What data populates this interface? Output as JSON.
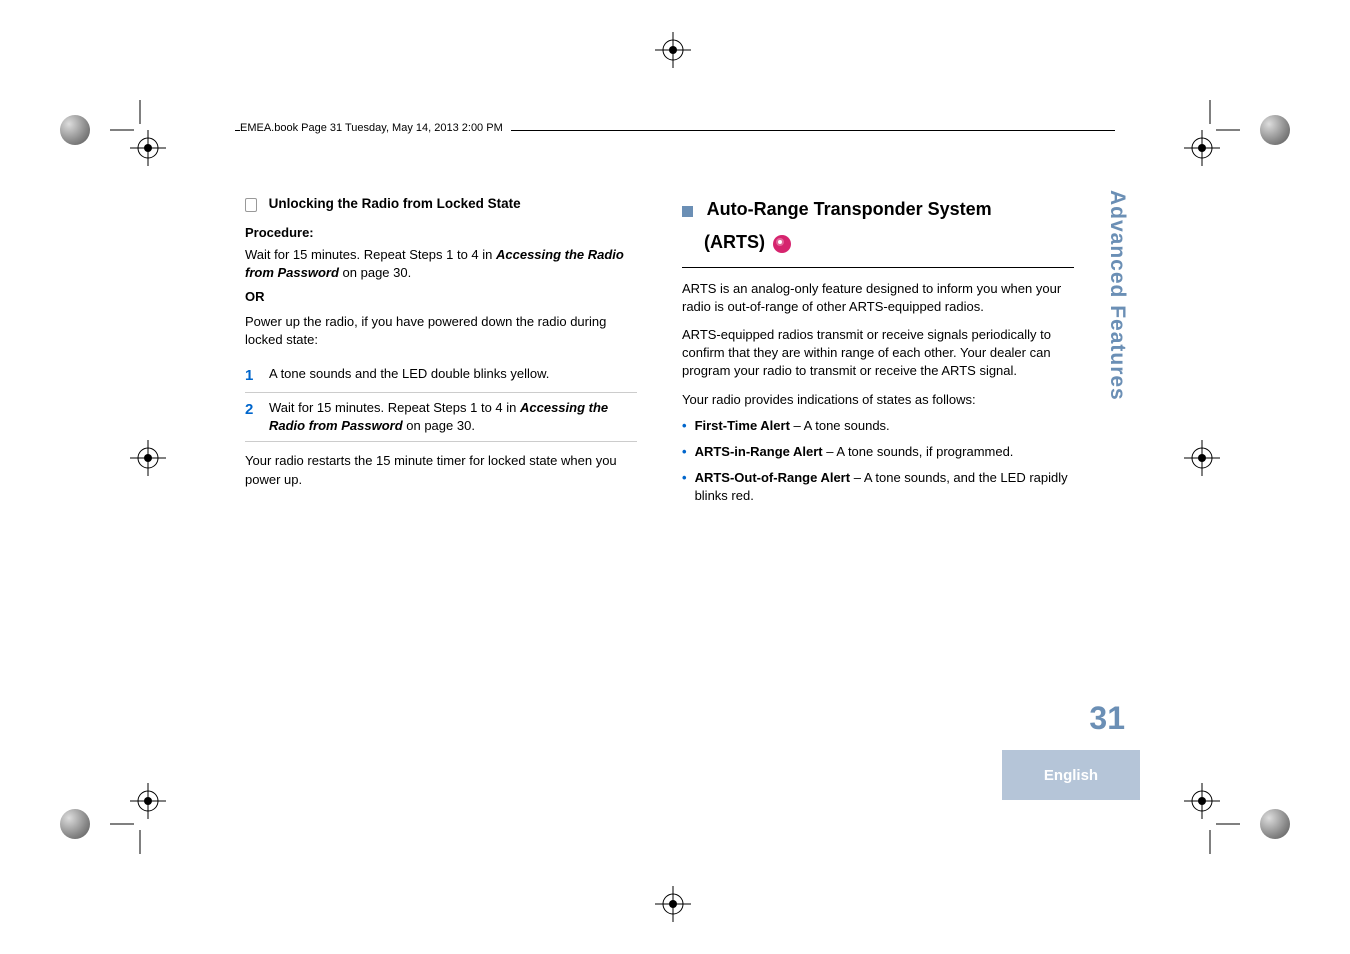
{
  "header": "EMEA.book  Page 31  Tuesday, May 14, 2013  2:00 PM",
  "leftColumn": {
    "sectionTitle": "Unlocking the Radio from Locked State",
    "procedureLabel": "Procedure:",
    "intro1a": "Wait for 15 minutes. Repeat Steps 1 to 4 in ",
    "intro1b": "Accessing the Radio from Password",
    "intro1c": " on page 30.",
    "or": "OR",
    "intro2": "Power up the radio, if you have powered down the radio during locked state:",
    "step1num": "1",
    "step1text": "A tone sounds and the LED double blinks yellow.",
    "step2num": "2",
    "step2a": "Wait for 15 minutes. Repeat Steps 1 to 4 in ",
    "step2b": "Accessing the Radio from Password",
    "step2c": " on page 30.",
    "closing": "Your radio restarts the 15 minute timer for locked state when you power up."
  },
  "rightColumn": {
    "heading1": "Auto-Range Transponder System",
    "heading2": "(ARTS)",
    "para1": "ARTS is an analog-only feature designed to inform you when your radio is out-of-range of other ARTS-equipped radios.",
    "para2": "ARTS-equipped radios transmit or receive signals periodically to confirm that they are within range of each other. Your dealer can program your radio to transmit or receive the ARTS signal.",
    "para3": "Your radio provides indications of states as follows:",
    "bullet1a": "First-Time Alert",
    "bullet1b": " – A tone sounds.",
    "bullet2a": "ARTS-in-Range Alert",
    "bullet2b": " – A tone sounds, if programmed.",
    "bullet3a": "ARTS-Out-of-Range Alert",
    "bullet3b": " – A tone sounds, and the LED rapidly blinks red."
  },
  "sidebar": "Advanced Features",
  "pageNumber": "31",
  "languageLabel": "English"
}
